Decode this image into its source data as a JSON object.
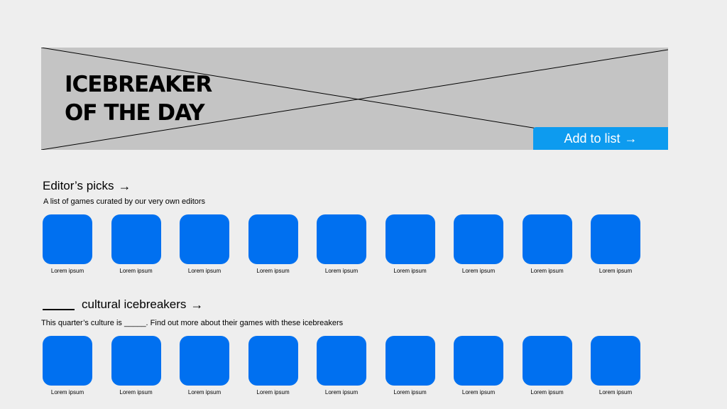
{
  "hero": {
    "title_line1": "ICEBREAKER",
    "title_line2": "OF THE DAY",
    "add_label": "Add to list",
    "add_arrow": "→"
  },
  "sections": [
    {
      "heading": "Editor’s picks",
      "arrow": "→",
      "description": "A list of games curated by our very own editors",
      "items": [
        {
          "label": "Lorem ipsum"
        },
        {
          "label": "Lorem ipsum"
        },
        {
          "label": "Lorem ipsum"
        },
        {
          "label": "Lorem ipsum"
        },
        {
          "label": "Lorem ipsum"
        },
        {
          "label": "Lorem ipsum"
        },
        {
          "label": "Lorem ipsum"
        },
        {
          "label": "Lorem ipsum"
        },
        {
          "label": "Lorem ipsum"
        }
      ]
    },
    {
      "heading": "cultural icebreakers",
      "arrow": "→",
      "description": "This quarter’s culture is _____. Find out more about their games with these icebreakers",
      "items": [
        {
          "label": "Lorem ipsum"
        },
        {
          "label": "Lorem ipsum"
        },
        {
          "label": "Lorem ipsum"
        },
        {
          "label": "Lorem ipsum"
        },
        {
          "label": "Lorem ipsum"
        },
        {
          "label": "Lorem ipsum"
        },
        {
          "label": "Lorem ipsum"
        },
        {
          "label": "Lorem ipsum"
        },
        {
          "label": "Lorem ipsum"
        }
      ]
    }
  ],
  "colors": {
    "background": "#eeeeee",
    "hero_placeholder": "#c4c4c4",
    "button": "#0d9bef",
    "tile": "#0070f0"
  },
  "icons": {
    "arrow": "arrow-right-icon",
    "tile": "game-tile-icon"
  }
}
